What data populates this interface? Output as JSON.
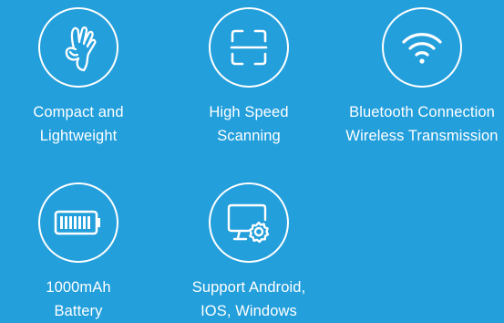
{
  "features": [
    {
      "icon": "ok-hand-icon",
      "line1": "Compact and",
      "line2": "Lightweight"
    },
    {
      "icon": "scan-frame-icon",
      "line1": "High Speed",
      "line2": "Scanning"
    },
    {
      "icon": "wifi-icon",
      "line1": "Bluetooth Connection",
      "line2": "Wireless Transmission"
    },
    {
      "icon": "battery-icon",
      "line1": "1000mAh",
      "line2": "Battery"
    },
    {
      "icon": "monitor-settings-icon",
      "line1": "Support Android,",
      "line2": "IOS, Windows"
    }
  ],
  "colors": {
    "background": "#239fdc",
    "foreground": "#ffffff"
  }
}
